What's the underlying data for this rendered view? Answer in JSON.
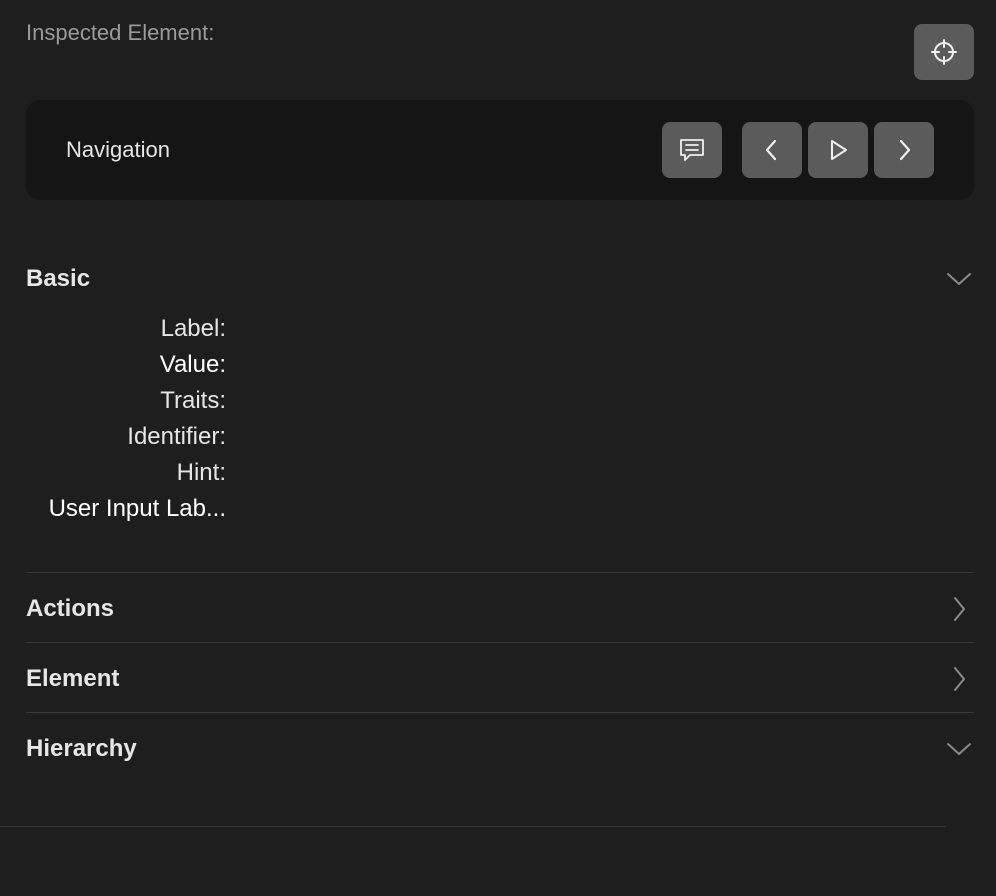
{
  "header": {
    "title": "Inspected Element:",
    "target_icon": "crosshair-icon"
  },
  "navigation": {
    "label": "Navigation",
    "buttons": [
      {
        "name": "speech-icon"
      },
      {
        "name": "chevron-left-icon"
      },
      {
        "name": "play-icon"
      },
      {
        "name": "chevron-right-icon"
      }
    ]
  },
  "basic": {
    "title": "Basic",
    "expanded": true,
    "fields": [
      {
        "label": "Label:"
      },
      {
        "label": "Value:"
      },
      {
        "label": "Traits:"
      },
      {
        "label": "Identifier:"
      },
      {
        "label": "Hint:"
      },
      {
        "label": "User Input Lab..."
      }
    ]
  },
  "sections": [
    {
      "title": "Actions",
      "expanded": false
    },
    {
      "title": "Element",
      "expanded": false
    },
    {
      "title": "Hierarchy",
      "expanded": true
    }
  ],
  "colors": {
    "background": "#1e1e1e",
    "panel": "#151515",
    "button": "#5b5b5b",
    "text": "#e6e6e6",
    "muted_text": "#9b9b9b",
    "divider": "#3a3a3a"
  }
}
